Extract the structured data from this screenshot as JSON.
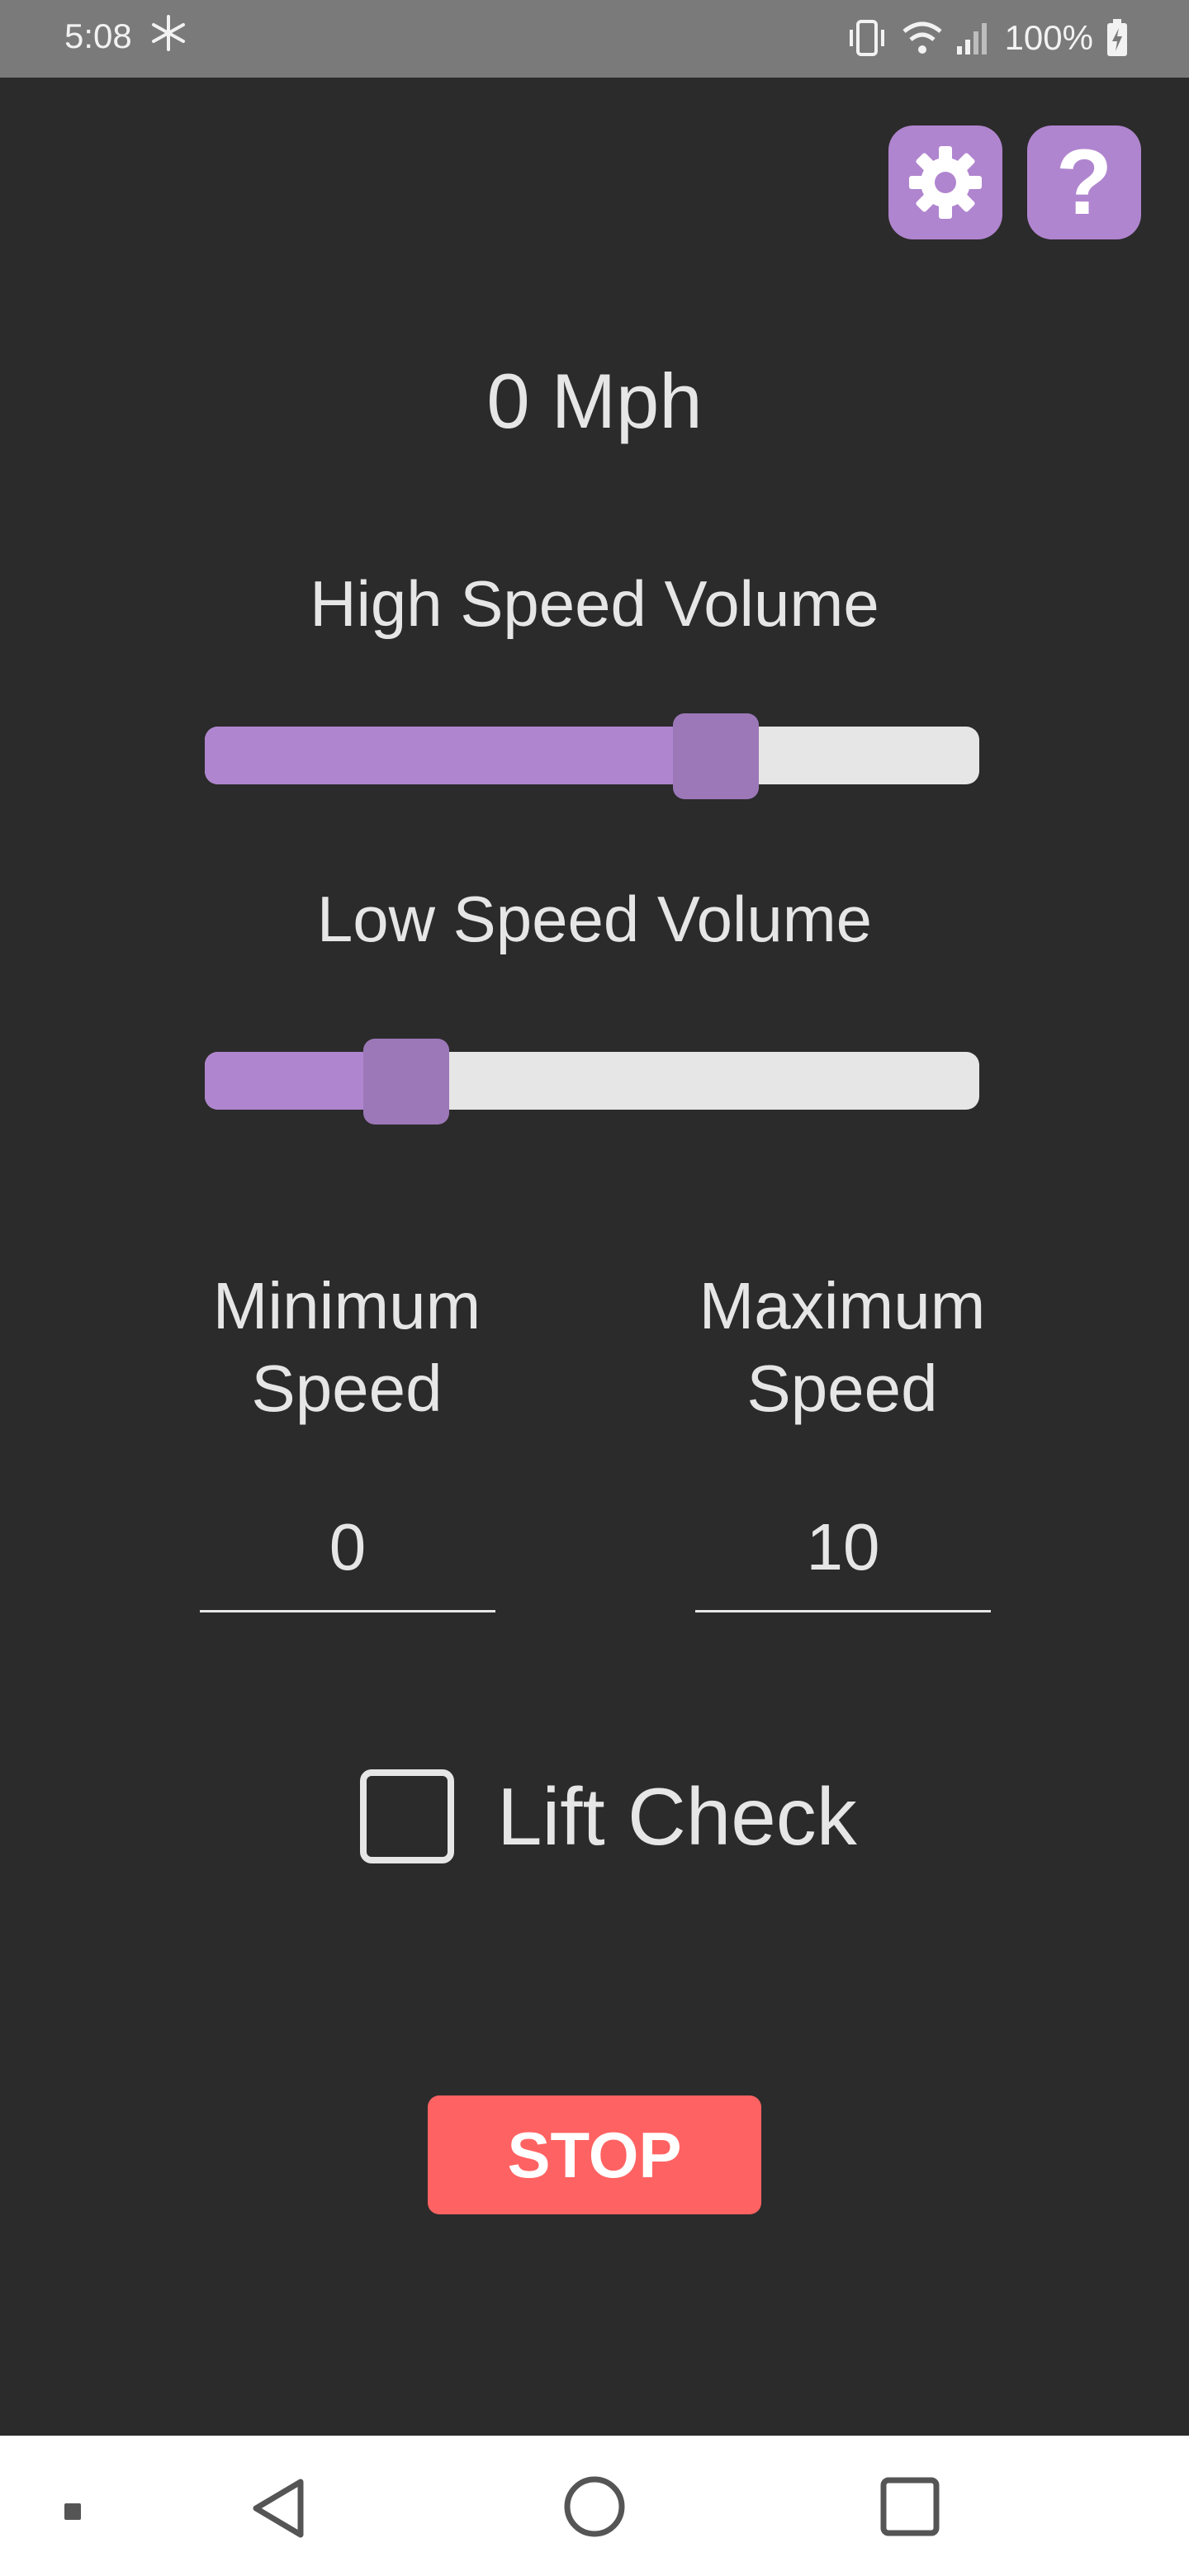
{
  "status_bar": {
    "time": "5:08",
    "battery_text": "100%",
    "icons": [
      "snowflake-icon",
      "vibrate-icon",
      "wifi-icon",
      "signal-icon",
      "battery-charging-icon"
    ]
  },
  "toolbar": {
    "settings_icon": "gear-icon",
    "help_label": "?"
  },
  "speed": {
    "text": "0 Mph"
  },
  "high_speed_volume": {
    "label": "High Speed Volume",
    "value_percent": 66
  },
  "low_speed_volume": {
    "label": "Low Speed Volume",
    "value_percent": 26
  },
  "minimum_speed": {
    "label_line1": "Minimum",
    "label_line2": "Speed",
    "value": "0"
  },
  "maximum_speed": {
    "label_line1": "Maximum",
    "label_line2": "Speed",
    "value": "10"
  },
  "lift_check": {
    "label": "Lift Check",
    "checked": false
  },
  "stop_button": {
    "label": "STOP"
  },
  "nav_bar": {
    "icons": [
      "recents-dot-icon",
      "back-icon",
      "home-icon",
      "overview-icon"
    ]
  },
  "colors": {
    "accent": "#b085cf",
    "thumb": "#9c78b8",
    "stop": "#ff6262",
    "background": "#2b2b2b"
  }
}
